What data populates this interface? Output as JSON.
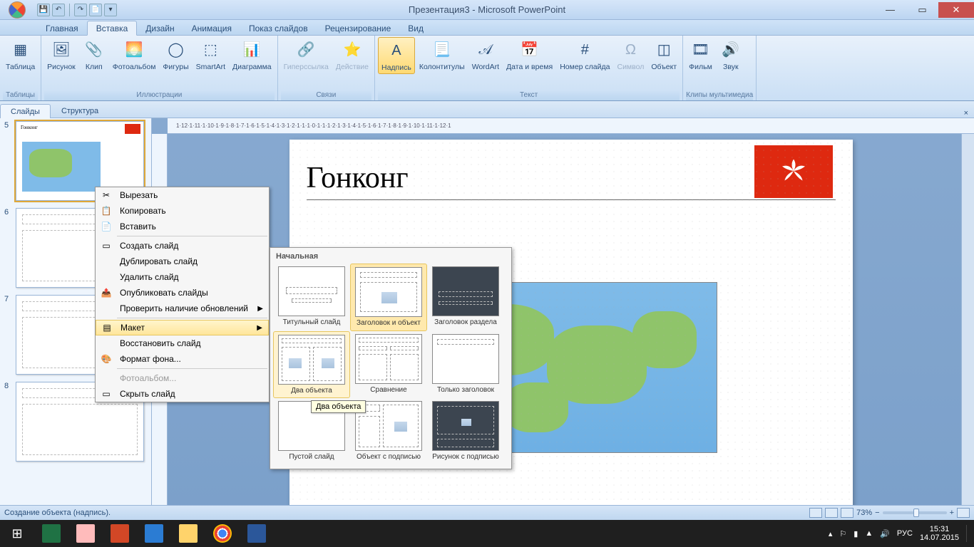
{
  "title": "Презентация3 - Microsoft PowerPoint",
  "qat": {
    "save": "💾",
    "undo": "↶",
    "redo": "↷",
    "print": "📄"
  },
  "tabs": [
    "Главная",
    "Вставка",
    "Дизайн",
    "Анимация",
    "Показ слайдов",
    "Рецензирование",
    "Вид"
  ],
  "active_tab": "Вставка",
  "ribbon": {
    "groups": [
      {
        "label": "Таблицы",
        "items": [
          {
            "name": "Таблица",
            "icon": "▦"
          }
        ]
      },
      {
        "label": "Иллюстрации",
        "items": [
          {
            "name": "Рисунок",
            "icon": "🖼"
          },
          {
            "name": "Клип",
            "icon": "📎"
          },
          {
            "name": "Фотоальбом",
            "icon": "🌅"
          },
          {
            "name": "Фигуры",
            "icon": "◯"
          },
          {
            "name": "SmartArt",
            "icon": "⬚"
          },
          {
            "name": "Диаграмма",
            "icon": "📊"
          }
        ]
      },
      {
        "label": "Связи",
        "items": [
          {
            "name": "Гиперссылка",
            "icon": "🔗",
            "disabled": true
          },
          {
            "name": "Действие",
            "icon": "⭐",
            "disabled": true
          }
        ]
      },
      {
        "label": "Текст",
        "items": [
          {
            "name": "Надпись",
            "icon": "A",
            "active": true
          },
          {
            "name": "Колонтитулы",
            "icon": "📃"
          },
          {
            "name": "WordArt",
            "icon": "𝒜"
          },
          {
            "name": "Дата и время",
            "icon": "📅"
          },
          {
            "name": "Номер слайда",
            "icon": "#"
          },
          {
            "name": "Символ",
            "icon": "Ω",
            "disabled": true
          },
          {
            "name": "Объект",
            "icon": "◫"
          }
        ]
      },
      {
        "label": "Клипы мультимедиа",
        "items": [
          {
            "name": "Фильм",
            "icon": "🎞"
          },
          {
            "name": "Звук",
            "icon": "🔊"
          }
        ]
      }
    ]
  },
  "panel": {
    "tabs": [
      "Слайды",
      "Структура"
    ],
    "active": "Слайды",
    "close": "×"
  },
  "slides": [
    5,
    6,
    7,
    8
  ],
  "selected_slide": 5,
  "slide_title": "Гонконг",
  "ruler": "1·12·1·11·1·10·1·9·1·8·1·7·1·6·1·5·1·4·1·3·1·2·1·1·1·0·1·1·1·2·1·3·1·4·1·5·1·6·1·7·1·8·1·9·1·10·1·11·1·12·1",
  "context_menu": [
    {
      "label": "Вырезать",
      "icon": "✂"
    },
    {
      "label": "Копировать",
      "icon": "📋"
    },
    {
      "label": "Вставить",
      "icon": "📄"
    },
    {
      "sep": true
    },
    {
      "label": "Создать слайд",
      "icon": "▭"
    },
    {
      "label": "Дублировать слайд"
    },
    {
      "label": "Удалить слайд"
    },
    {
      "label": "Опубликовать слайды",
      "icon": "📤"
    },
    {
      "label": "Проверить наличие обновлений",
      "arrow": true
    },
    {
      "sep": true
    },
    {
      "label": "Макет",
      "icon": "▤",
      "hl": true,
      "arrow": true
    },
    {
      "label": "Восстановить слайд"
    },
    {
      "label": "Формат фона...",
      "icon": "🎨"
    },
    {
      "sep": true
    },
    {
      "label": "Фотоальбом...",
      "disabled": true
    },
    {
      "label": "Скрыть слайд",
      "icon": "▭"
    }
  ],
  "layout_flyout": {
    "header": "Начальная",
    "items": [
      {
        "label": "Титульный слайд"
      },
      {
        "label": "Заголовок и объект",
        "sel": true
      },
      {
        "label": "Заголовок раздела",
        "dark": true
      },
      {
        "label": "Два объекта",
        "hov": true
      },
      {
        "label": "Сравнение"
      },
      {
        "label": "Только заголовок"
      },
      {
        "label": "Пустой слайд"
      },
      {
        "label": "Объект с подписью"
      },
      {
        "label": "Рисунок с подписью",
        "dark": true
      }
    ]
  },
  "tooltip": "Два объекта",
  "status": {
    "left": "Создание объекта (надпись).",
    "zoom": "73%"
  },
  "taskbar": {
    "lang": "РУС",
    "time": "15:31",
    "date": "14.07.2015"
  }
}
